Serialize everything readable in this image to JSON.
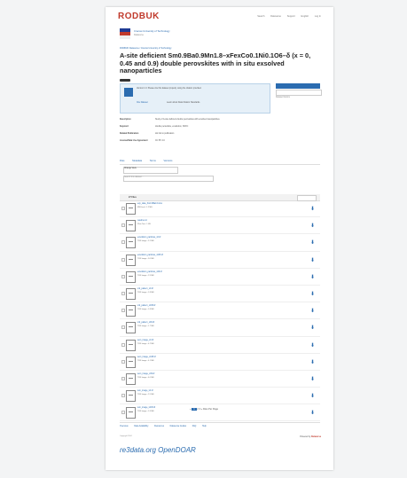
{
  "header": {
    "logo": "RODBUK",
    "nav": [
      "Search",
      "Dataverse",
      "Support",
      "English",
      "Log In"
    ]
  },
  "organization": {
    "name": "Cracow University of Technology",
    "sub": "Dataverse"
  },
  "breadcrumb": "RODBUK Dataverse / Cracow University of Technology",
  "title": "A-site deficient Sm0.9Ba0.9Mn1.8–xFexCo0.1Ni0.1O6–δ (x = 0, 0.45 and 0.9) double perovskites with in situ exsolved nanoparticles",
  "infobox": {
    "text": "Version 1.0. Please cite this dataset properly using the citation provided.",
    "link1": "Cite Dataset",
    "link2": "Learn about Data Citation Standards."
  },
  "sidebar": {
    "primary_button": "Access Dataset",
    "secondary_button": "Contact Owner",
    "info": "Dataset Metrics"
  },
  "metadata": [
    {
      "key": "Description",
      "value": "Study of A-site deficient double perovskites with exsolved nanoparticles."
    },
    {
      "key": "Keyword",
      "value": "double perovskite, exsolution, SOFC"
    },
    {
      "key": "Related Publication",
      "value": "doi link to publication"
    },
    {
      "key": "License/Data Use Agreement",
      "value": "CC BY 4.0"
    }
  ],
  "tabs": [
    "Files",
    "Metadata",
    "Terms",
    "Versions"
  ],
  "controls": {
    "change_view": "Change View",
    "search_placeholder": "Search this dataset..."
  },
  "list_header": "27 Files",
  "files": [
    {
      "name": "exp_data_Sm0.9Ba0.9.xlsx",
      "detail": "MS Excel - 1.2 MB"
    },
    {
      "name": "readme.txt",
      "detail": "Plain Text - 1 KB"
    },
    {
      "name": "exsolution_particles_x0.tif",
      "detail": "TIFF Image - 3.1 MB"
    },
    {
      "name": "exsolution_particles_x045.tif",
      "detail": "TIFF Image - 3.0 MB"
    },
    {
      "name": "exsolution_particles_x09.tif",
      "detail": "TIFF Image - 2.9 MB"
    },
    {
      "name": "xrd_pattern_x0.tif",
      "detail": "TIFF Image - 1.8 MB"
    },
    {
      "name": "xrd_pattern_x045.tif",
      "detail": "TIFF Image - 1.8 MB"
    },
    {
      "name": "xrd_pattern_x09.tif",
      "detail": "TIFF Image - 1.7 MB"
    },
    {
      "name": "sem_image_x0.tif",
      "detail": "TIFF Image - 4.2 MB"
    },
    {
      "name": "sem_image_x045.tif",
      "detail": "TIFF Image - 4.1 MB"
    },
    {
      "name": "sem_image_x09.tif",
      "detail": "TIFF Image - 4.0 MB"
    },
    {
      "name": "tem_image_x0.tif",
      "detail": "TIFF Image - 2.5 MB"
    },
    {
      "name": "tem_image_x045.tif",
      "detail": "TIFF Image - 2.4 MB"
    }
  ],
  "pager": {
    "pages": [
      "1",
      "2",
      "3"
    ],
    "current": "1",
    "files_per_page": "Files Per Page"
  },
  "footer": {
    "nav": [
      "Overview",
      "Data Availability",
      "Resources",
      "Dataverse Guides",
      "FAQ",
      "Help"
    ],
    "copyright": "Copyright 2024",
    "powered_by": "Powered by",
    "powered_brand": "Dataverse",
    "partner": "re3data.org OpenDOAR"
  }
}
